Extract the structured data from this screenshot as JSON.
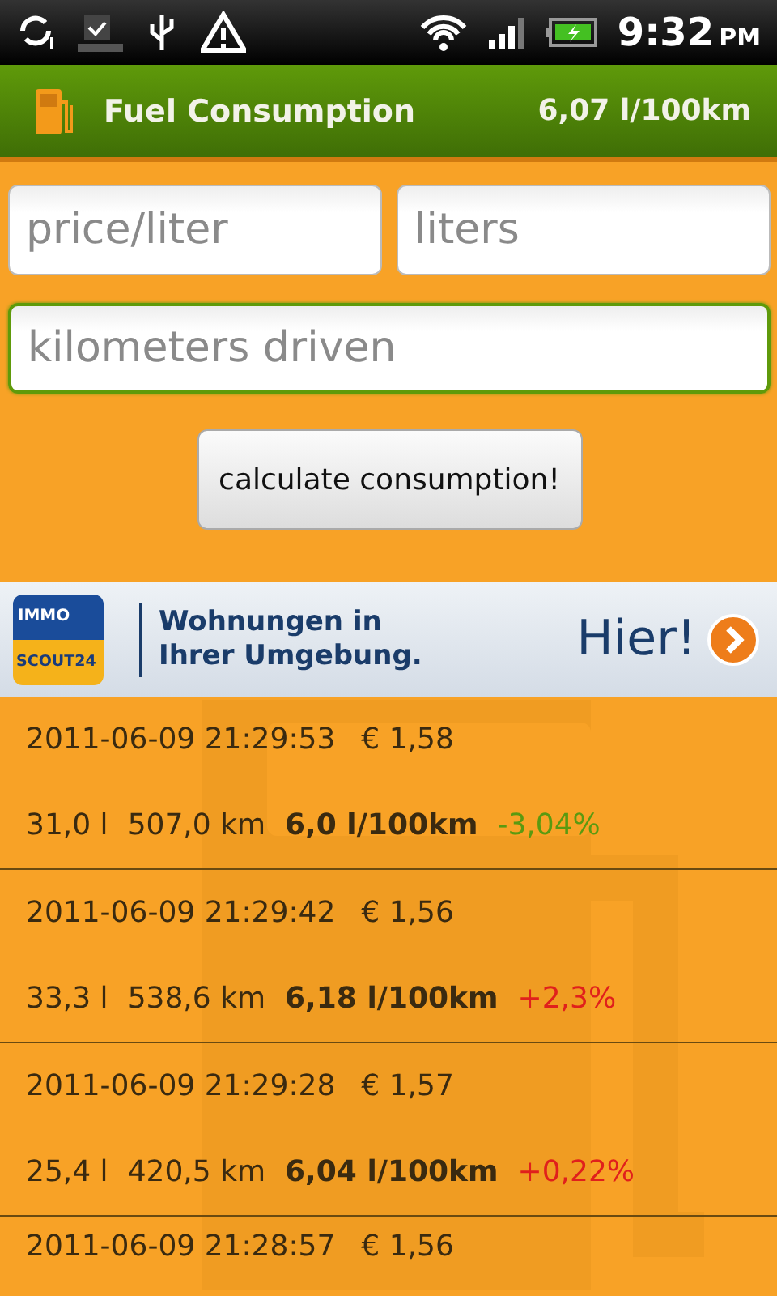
{
  "status_bar": {
    "time": "9:32",
    "ampm": "PM"
  },
  "app_bar": {
    "title": "Fuel Consumption",
    "average": "6,07 l/100km"
  },
  "form": {
    "fields": [
      {
        "placeholder": "price/liter",
        "focused": false
      },
      {
        "placeholder": "liters",
        "focused": false
      },
      {
        "placeholder": "kilometers driven",
        "focused": true
      }
    ],
    "button": "calculate consumption!"
  },
  "ad": {
    "logo_top": "IMMO",
    "logo_bottom": "SCOUT24",
    "headline": [
      "Wohnungen in",
      "Ihrer Umgebung."
    ],
    "cta": "Hier!"
  },
  "entries": [
    {
      "date": "2011-06-09 21:29:53",
      "price": "€ 1,58",
      "liters": "31,0 l",
      "distance": "507,0 km",
      "consumption": "6,0 l/100km",
      "change": "-3,04%",
      "color": "#5a9a10"
    },
    {
      "date": "2011-06-09 21:29:42",
      "price": "€ 1,56",
      "liters": "33,3 l",
      "distance": "538,6 km",
      "consumption": "6,18 l/100km",
      "change": "+2,3%",
      "color": "#e0201c"
    },
    {
      "date": "2011-06-09 21:29:28",
      "price": "€ 1,57",
      "liters": "25,4 l",
      "distance": "420,5 km",
      "consumption": "6,04 l/100km",
      "change": "+0,22%",
      "color": "#e0201c"
    },
    {
      "date": "2011-06-09 21:28:57",
      "price": "€ 1,56"
    }
  ]
}
